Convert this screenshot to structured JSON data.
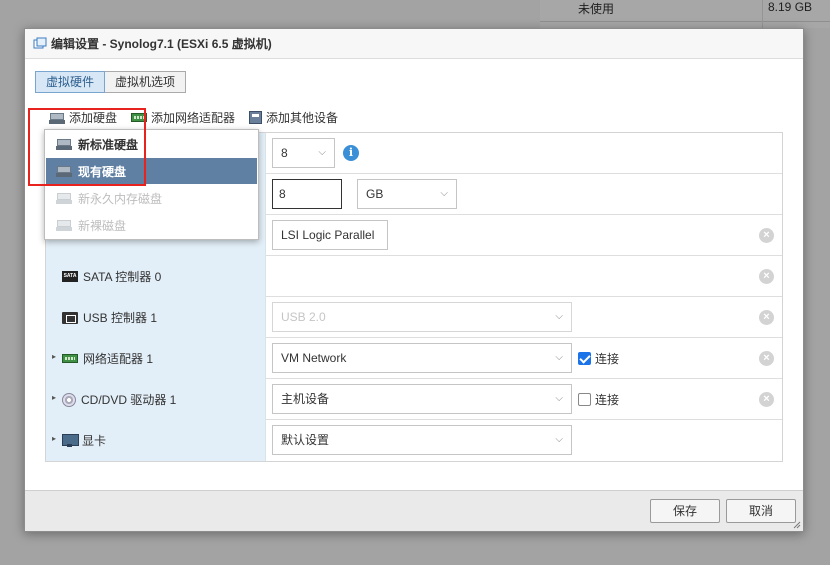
{
  "background": {
    "unused_label": "未使用",
    "unused_value": "8.19 GB"
  },
  "dialog": {
    "title": "编辑设置 - Synolog7.1 (ESXi 6.5 虚拟机)",
    "tabs": [
      {
        "label": "虚拟硬件",
        "active": true
      },
      {
        "label": "虚拟机选项",
        "active": false
      }
    ],
    "toolbar": {
      "add_disk": "添加硬盘",
      "add_network": "添加网络适配器",
      "add_other": "添加其他设备"
    },
    "dropdown": {
      "items": [
        {
          "label": "新标准硬盘",
          "state": "normal"
        },
        {
          "label": "现有硬盘",
          "state": "selected"
        },
        {
          "label": "新永久内存磁盘",
          "state": "disabled"
        },
        {
          "label": "新裸磁盘",
          "state": "disabled"
        }
      ]
    },
    "rows": {
      "cpu": {
        "value": "8"
      },
      "memory": {
        "value": "8",
        "unit": "GB"
      },
      "scsi": {
        "value": "LSI Logic Parallel"
      },
      "sata": {
        "label": "SATA 控制器 0",
        "badge": "SATA"
      },
      "usb": {
        "label": "USB 控制器 1",
        "value": "USB 2.0"
      },
      "network": {
        "label": "网络适配器 1",
        "value": "VM Network",
        "connect_label": "连接",
        "connected": true
      },
      "cddvd": {
        "label": "CD/DVD 驱动器 1",
        "value": "主机设备",
        "connect_label": "连接",
        "connected": false
      },
      "video": {
        "label": "显卡",
        "value": "默认设置"
      }
    },
    "footer": {
      "save": "保存",
      "cancel": "取消"
    },
    "icons": {
      "info": "i",
      "remove": "×",
      "caret": "▸",
      "chevron": "⌵"
    }
  }
}
